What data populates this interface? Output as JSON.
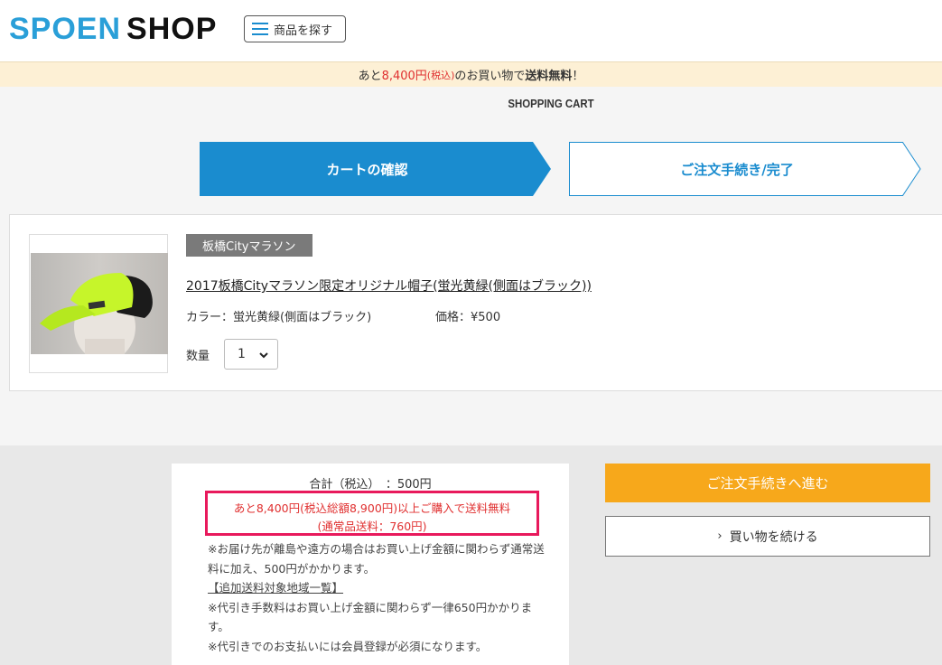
{
  "header": {
    "logo_part1": "SPOEN",
    "logo_part2": "SHOP",
    "menu_label": "商品を探す"
  },
  "notice": {
    "prefix": "あと",
    "amount": "8,400円",
    "tax": "(税込)",
    "middle": "のお買い物で",
    "emphasis": "送料無料",
    "suffix": "！"
  },
  "cart_title": "SHOPPING CART",
  "steps": [
    {
      "label": "カートの確認",
      "active": true
    },
    {
      "label": "ご注文手続き/完了",
      "active": false
    }
  ],
  "item": {
    "category": "板橋Cityマラソン",
    "name": "2017板橋Cityマラソン限定オリジナル帽子(蛍光黄緑(側面はブラック))",
    "color": "カラー：蛍光黄緑(側面はブラック)",
    "price": "価格：¥500",
    "qty_label": "数量",
    "qty_value": "1"
  },
  "summary": {
    "total": "合計（税込）　：500円",
    "shipping_line1": "あと8,400円(税込総額8,900円)以上ご購入で送料無料",
    "shipping_line2": "(通常品送料：760円)",
    "note1": "※お届け先が離島や遠方の場合はお買い上げ金額に関わらず通常送料に加え、500円がかかります。",
    "note_link": "【追加送料対象地域一覧】",
    "note2": "※代引き手数料はお買い上げ金額に関わらず一律650円かかります。",
    "note3": "※代引きでのお支払いには会員登録が必須になります。"
  },
  "buttons": {
    "checkout": "ご注文手続きへ進む",
    "continue": "買い物を続ける"
  },
  "colors": {
    "brand_blue": "#1a8ccf",
    "accent_orange": "#f7a81b",
    "highlight_red": "#e03030",
    "box_border": "#e8195c"
  }
}
